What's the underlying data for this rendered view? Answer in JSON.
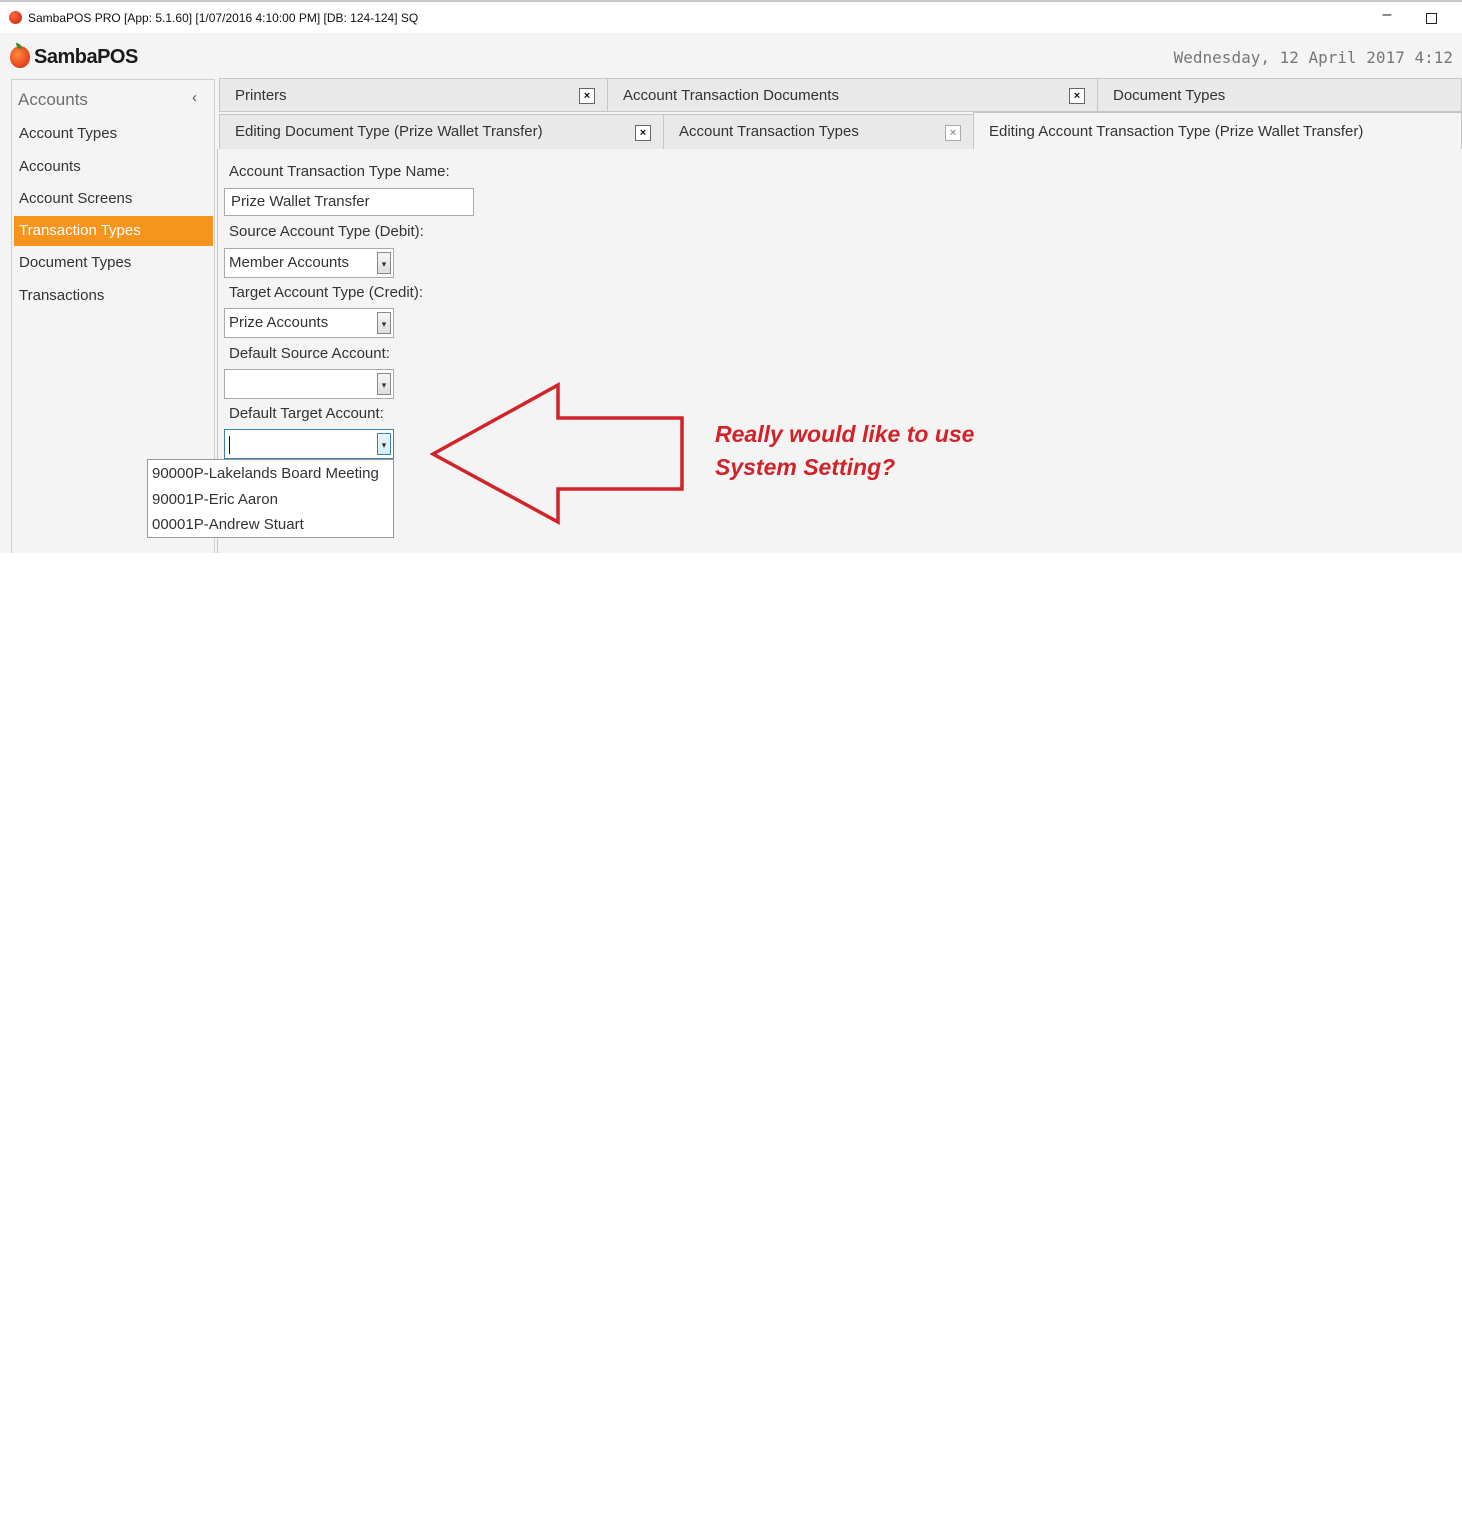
{
  "window": {
    "title": "SambaPOS PRO [App: 5.1.60] [1/07/2016 4:10:00 PM] [DB: 124-124] SQ",
    "minimize_glyph": "–"
  },
  "header": {
    "logo_text": "SambaPOS",
    "clock": "Wednesday, 12 April 2017 4:12"
  },
  "sidebar": {
    "title": "Accounts",
    "collapse_glyph": "‹",
    "items": [
      {
        "label": "Account Types"
      },
      {
        "label": "Accounts"
      },
      {
        "label": "Account Screens"
      },
      {
        "label": "Transaction Types",
        "active": true
      },
      {
        "label": "Document Types"
      },
      {
        "label": "Transactions"
      }
    ]
  },
  "tabs": {
    "row1": [
      {
        "label": "Printers"
      },
      {
        "label": "Account Transaction Documents"
      },
      {
        "label": "Document Types"
      }
    ],
    "row2": [
      {
        "label": "Editing Document Type (Prize Wallet Transfer)"
      },
      {
        "label": "Account Transaction Types"
      },
      {
        "label": "Editing Account Transaction Type (Prize Wallet Transfer)",
        "active": true
      }
    ],
    "close_glyph": "×"
  },
  "form": {
    "name_label": "Account Transaction Type Name:",
    "name_value": "Prize Wallet Transfer",
    "source_type_label": "Source Account Type (Debit):",
    "source_type_value": "Member Accounts",
    "target_type_label": "Target Account Type (Credit):",
    "target_type_value": "Prize Accounts",
    "default_source_label": "Default Source Account:",
    "default_source_value": "",
    "default_target_label": "Default Target Account:",
    "default_target_value": "",
    "dropdown_glyph": "▾"
  },
  "dropdown_options": [
    "90000P-Lakelands Board Meeting",
    "90001P-Eric Aaron",
    "00001P-Andrew Stuart"
  ],
  "annotation": {
    "line1": "Really would like to use",
    "line2": "System Setting?",
    "color": "#d2232a"
  },
  "colors": {
    "accent": "#f7941d",
    "background": "#f4f4f4"
  }
}
